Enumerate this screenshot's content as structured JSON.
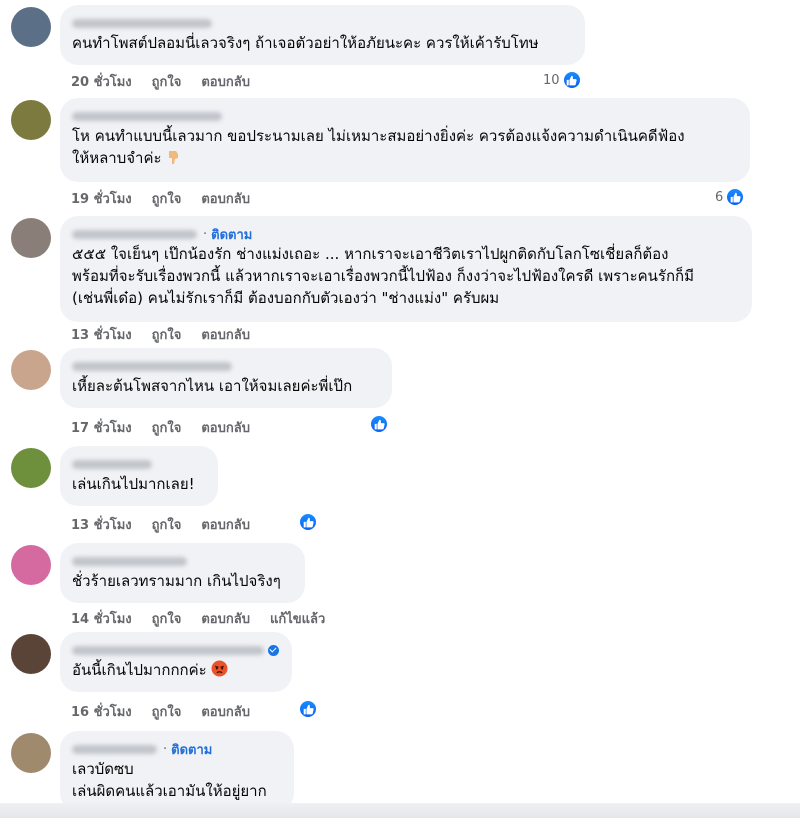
{
  "comments": [
    {
      "text": "คนทำโพสต์ปลอมนี่เลวจริงๆ ถ้าเจอตัวอย่าให้อภัยนะคะ ควรให้เค้ารับโทษ",
      "time": "20 ชั่วโมง",
      "like_label": "ถูกใจ",
      "reply_label": "ตอบกลับ",
      "reactions": "10",
      "avatar_color": "#5b6f86"
    },
    {
      "text": "โห คนทำแบบนี้เลวมาก ขอประนามเลย ไม่เหมาะสมอย่างยิ่งค่ะ ควรต้องแจ้งความดำเนินคดีฟ้อง\nให้หลาบจำค่ะ",
      "time": "19 ชั่วโมง",
      "like_label": "ถูกใจ",
      "reply_label": "ตอบกลับ",
      "reactions": "6",
      "avatar_color": "#7c7a3e"
    },
    {
      "follow_label": "ติดตาม",
      "text": "๕๕๕ ใจเย็นๆ เป๊กน้องรัก ช่างแม่งเถอะ ... หากเราจะเอาชีวิตเราไปผูกติดกับโลกโซเชี่ยลก็ต้อง\nพร้อมที่จะรับเรื่องพวกนี้ แล้วหากเราจะเอาเรื่องพวกนี้ไปฟ้อง ก็งงว่าจะไปฟ้องใครดี เพราะคนรักก็มี\n(เช่นพี่เด๋อ) คนไม่รักเราก็มี ต้องบอกกับตัวเองว่า \"ช่างแม่ง\" ครับผม",
      "time": "13 ชั่วโมง",
      "like_label": "ถูกใจ",
      "reply_label": "ตอบกลับ",
      "avatar_color": "#8a7f78"
    },
    {
      "text": "เหี้ยละต้นโพสจากไหน เอาให้จมเลยค่ะพี่เป๊ก",
      "time": "17 ชั่วโมง",
      "like_label": "ถูกใจ",
      "reply_label": "ตอบกลับ",
      "avatar_color": "#c9a58e"
    },
    {
      "text": "เล่นเกินไปมากเลย!",
      "time": "13 ชั่วโมง",
      "like_label": "ถูกใจ",
      "reply_label": "ตอบกลับ",
      "avatar_color": "#6e8f3c"
    },
    {
      "text": "ชั่วร้ายเลวทรามมาก เกินไปจริงๆ",
      "time": "14 ชั่วโมง",
      "like_label": "ถูกใจ",
      "reply_label": "ตอบกลับ",
      "edited_label": "แก้ไขแล้ว",
      "avatar_color": "#d46aa0"
    },
    {
      "text": "อันนี้เกินไปมากกกค่ะ",
      "time": "16 ชั่วโมง",
      "like_label": "ถูกใจ",
      "reply_label": "ตอบกลับ",
      "avatar_color": "#5a4438"
    },
    {
      "follow_label": "ติดตาม",
      "text": "เลวบัดซบ\nเล่นผิดคนแล้วเอามันให้อยู่ยาก",
      "avatar_color": "#a08a6e"
    }
  ],
  "colors": {
    "bubble": "#f0f2f5",
    "link_blue": "#216fdb",
    "like_blue": "#1b74e4",
    "meta_gray": "#65676b"
  }
}
